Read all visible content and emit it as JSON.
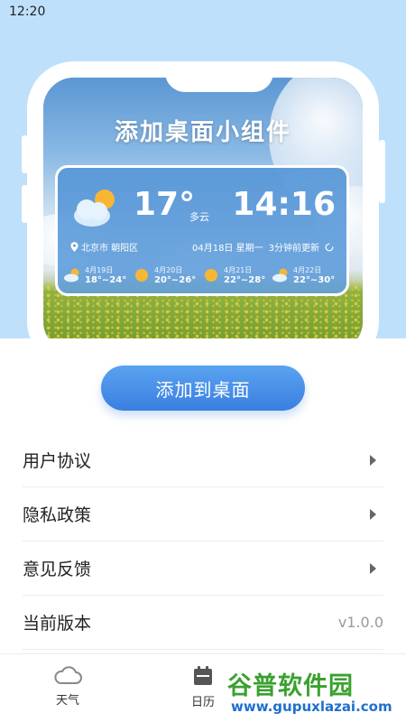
{
  "status_bar": {
    "time": "12:20"
  },
  "widget_preview": {
    "title": "添加桌面小组件",
    "current": {
      "temp": "17°",
      "condition": "多云",
      "time": "14:16"
    },
    "location": "北京市 朝阳区",
    "date_line": "04月18日 星期一",
    "updated": "3分钟前更新",
    "forecast": [
      {
        "date": "4月19日",
        "range": "18°~24°",
        "icon": "partly-cloudy-icon"
      },
      {
        "date": "4月20日",
        "range": "20°~26°",
        "icon": "sunny-icon"
      },
      {
        "date": "4月21日",
        "range": "22°~28°",
        "icon": "sunny-icon"
      },
      {
        "date": "4月22日",
        "range": "22°~30°",
        "icon": "partly-cloudy-icon"
      }
    ]
  },
  "actions": {
    "add_to_desktop": "添加到桌面"
  },
  "menu": [
    {
      "label": "用户协议",
      "type": "link"
    },
    {
      "label": "隐私政策",
      "type": "link"
    },
    {
      "label": "意见反馈",
      "type": "link"
    },
    {
      "label": "当前版本",
      "type": "value",
      "value": "v1.0.0"
    }
  ],
  "tabs": [
    {
      "label": "天气",
      "icon": "cloud-icon"
    },
    {
      "label": "日历",
      "icon": "calendar-icon"
    }
  ],
  "watermark": {
    "text": "谷普软件园",
    "url": "www.gupuxlazai.com"
  },
  "colors": {
    "accent": "#3a7fe0",
    "top_bg": "#bfe0fb",
    "watermark_green": "#3aa12f"
  }
}
